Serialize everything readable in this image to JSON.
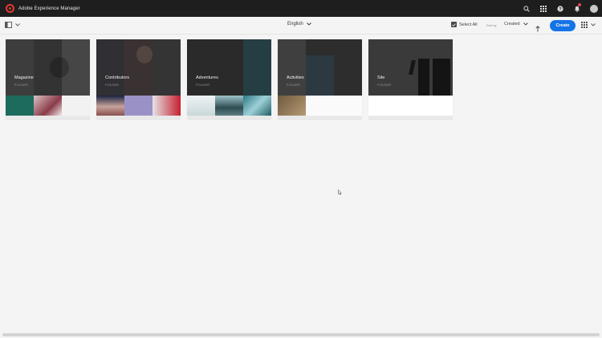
{
  "shell": {
    "title": "Adobe Experience Manager",
    "brand_color": "#e03a2f",
    "icons": [
      "search-icon",
      "apps-grid-icon",
      "help-icon",
      "notifications-bell-icon",
      "user-avatar"
    ]
  },
  "toolbar": {
    "language": "English",
    "select_all": "Select All",
    "sort_by_label": "Sort by",
    "sort_by_value": "Created",
    "create_label": "Create",
    "create_color": "#1473e6"
  },
  "cards": [
    {
      "title": "Magazine",
      "type": "FOLDER"
    },
    {
      "title": "Contributors",
      "type": "FOLDER"
    },
    {
      "title": "Adventures",
      "type": "FOLDER"
    },
    {
      "title": "Activities",
      "type": "FOLDER"
    },
    {
      "title": "Site",
      "type": "FOLDER"
    }
  ]
}
